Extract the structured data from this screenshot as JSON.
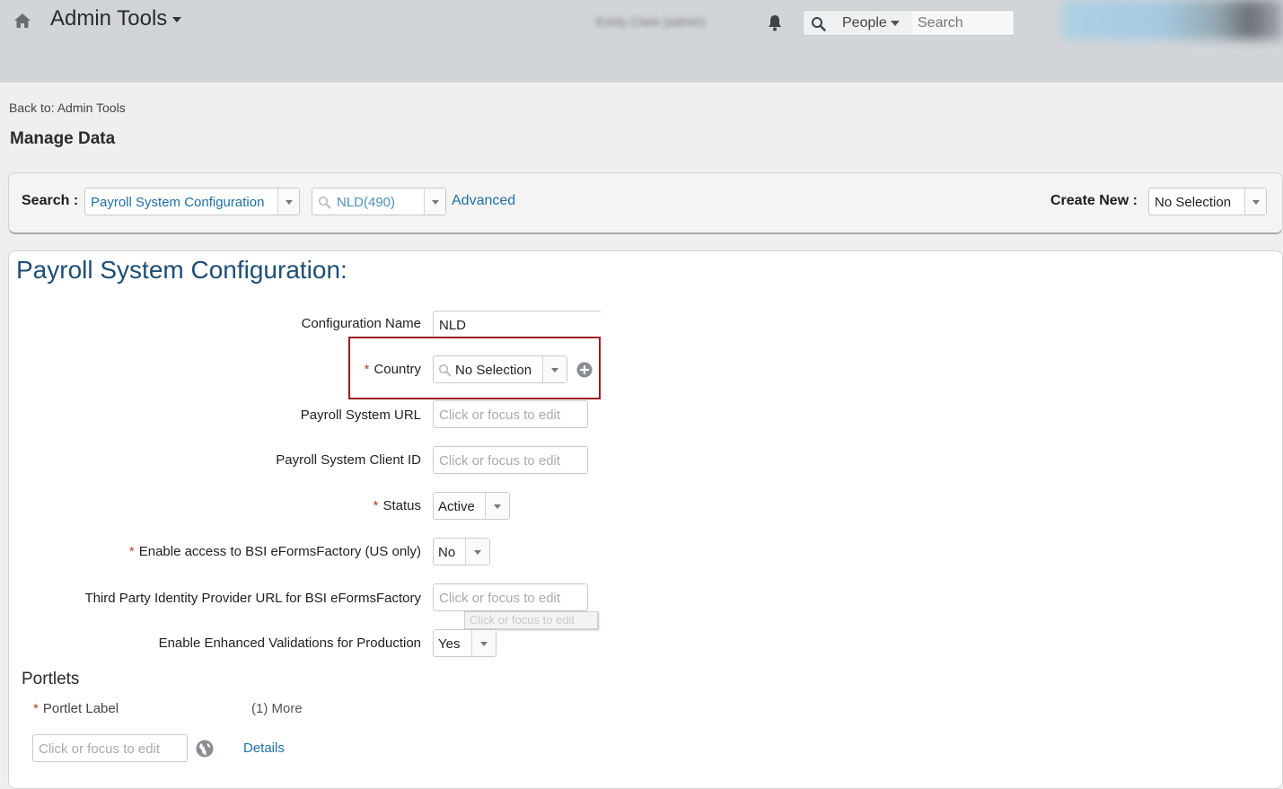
{
  "header": {
    "app_title": "Admin Tools",
    "user_name": "Emily Clark (admin)",
    "search_scope": "People",
    "search_placeholder": "Search"
  },
  "page": {
    "back_link": "Back to: Admin Tools",
    "title": "Manage Data"
  },
  "search_panel": {
    "search_label": "Search :",
    "search_type": "Payroll System Configuration",
    "search_key": "NLD(490)",
    "advanced_label": "Advanced",
    "create_new_label": "Create New :",
    "create_new_value": "No Selection"
  },
  "config": {
    "title": "Payroll System Configuration:",
    "fields": {
      "configuration_name": {
        "label": "Configuration Name",
        "value": "NLD"
      },
      "country": {
        "label": "Country",
        "required": "*",
        "value": "No Selection"
      },
      "payroll_system_url": {
        "label": "Payroll System URL",
        "placeholder": "Click or focus to edit"
      },
      "payroll_system_client_id": {
        "label": "Payroll System Client ID",
        "placeholder": "Click or focus to edit"
      },
      "status": {
        "label": "Status",
        "required": "*",
        "value": "Active"
      },
      "enable_bsi": {
        "label": "Enable access to BSI eFormsFactory (US only)",
        "required": "*",
        "value": "No"
      },
      "third_party_idp_url": {
        "label": "Third Party Identity Provider URL for BSI eFormsFactory",
        "placeholder": "Click or focus to edit"
      },
      "enhanced_validations": {
        "label": "Enable Enhanced Validations for Production",
        "value": "Yes"
      }
    },
    "tooltip": "Click or focus to edit"
  },
  "portlets": {
    "heading": "Portlets",
    "label_header": "Portlet Label",
    "required": "*",
    "more": "(1) More",
    "field_placeholder": "Click or focus to edit",
    "details_link": "Details"
  },
  "colors": {
    "accent_link": "#1f6fa5",
    "title_blue": "#1e4e76",
    "required_red": "#c0392b",
    "highlight_border": "#9b1b22"
  },
  "icons": [
    "home-icon",
    "bell-icon",
    "search-icon",
    "plus-circle-icon",
    "globe-icon",
    "chevron-down-icon"
  ]
}
